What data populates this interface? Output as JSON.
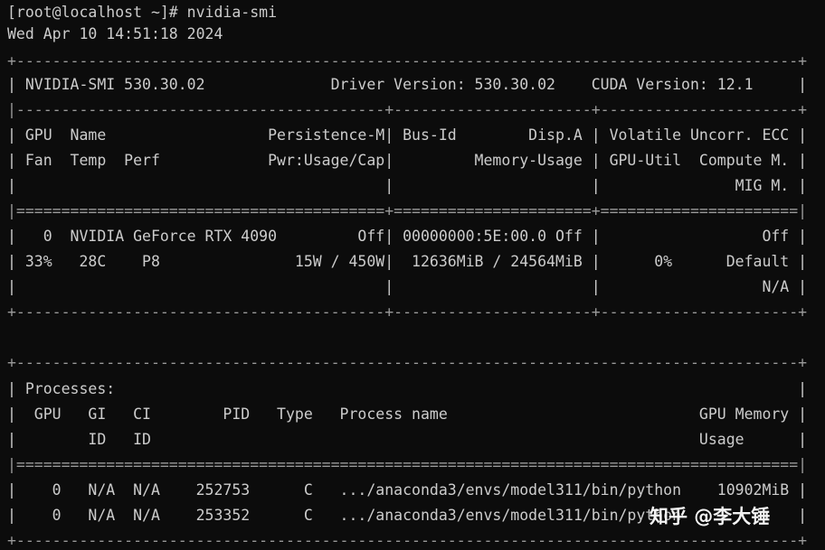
{
  "terminal": {
    "lines": [
      "[root@localhost ~]# nvidia-smi",
      "Wed Apr 10 14:51:18 2024",
      "+---------------------------------------------------------------------------------------+",
      "| NVIDIA-SMI 530.30.02              Driver Version: 530.30.02    CUDA Version: 12.1     |",
      "|-----------------------------------------+----------------------+----------------------+",
      "| GPU  Name                  Persistence-M| Bus-Id        Disp.A | Volatile Uncorr. ECC |",
      "| Fan  Temp  Perf            Pwr:Usage/Cap|         Memory-Usage | GPU-Util  Compute M. |",
      "|                                         |                      |               MIG M. |",
      "|=========================================+======================+======================|",
      "|   0  NVIDIA GeForce RTX 4090         Off| 00000000:5E:00.0 Off |                  Off |",
      "| 33%   28C    P8               15W / 450W|  12636MiB / 24564MiB |      0%      Default |",
      "|                                         |                      |                  N/A |",
      "+-----------------------------------------+----------------------+----------------------+",
      "",
      "",
      "+---------------------------------------------------------------------------------------+",
      "| Processes:                                                                            |",
      "|  GPU   GI   CI        PID   Type   Process name                            GPU Memory |",
      "|        ID   ID                                                             Usage      |",
      "|=======================================================================================|",
      "|    0   N/A  N/A    252753      C   .../anaconda3/envs/model311/bin/python    10902MiB |",
      "|    0   N/A  N/A    253352      C   .../anaconda3/envs/model311/bin/python             |",
      "+---------------------------------------------------------------------------------------+"
    ]
  },
  "watermark": {
    "text": "知乎 @李大锤"
  },
  "colors": {
    "background": "#0c0c0c",
    "text": "#cccccc",
    "border": "#9a9a9a"
  }
}
